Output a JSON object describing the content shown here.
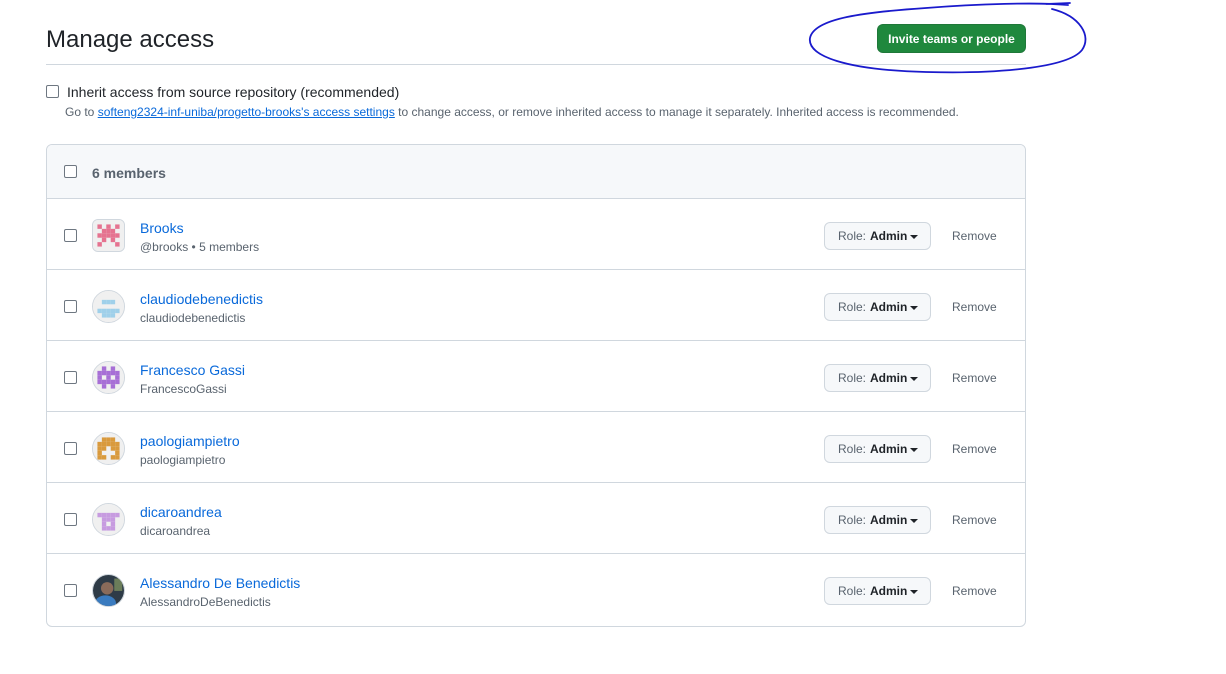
{
  "header": {
    "title": "Manage access",
    "invite_label": "Invite teams or people"
  },
  "inherit": {
    "label": "Inherit access from source repository (recommended)",
    "note_prefix": "Go to ",
    "note_link": "softeng2324-inf-uniba/progetto-brooks's access settings",
    "note_suffix": " to change access, or remove inherited access to manage it separately. Inherited access is recommended."
  },
  "members": {
    "count_label": "6 members",
    "role_prefix": "Role:",
    "remove_label": "Remove",
    "items": [
      {
        "name": "Brooks",
        "sub": "@brooks • 5 members",
        "role": "Admin",
        "avatar": "identicon-pink-team",
        "color": "#e57390"
      },
      {
        "name": "claudiodebenedictis",
        "sub": "claudiodebenedictis",
        "role": "Admin",
        "avatar": "identicon-lightblue",
        "color": "#9fd0ea"
      },
      {
        "name": "Francesco Gassi",
        "sub": "FrancescoGassi",
        "role": "Admin",
        "avatar": "identicon-purple",
        "color": "#a76fd6"
      },
      {
        "name": "paologiampietro",
        "sub": "paologiampietro",
        "role": "Admin",
        "avatar": "identicon-orange",
        "color": "#d99a3d"
      },
      {
        "name": "dicaroandrea",
        "sub": "dicaroandrea",
        "role": "Admin",
        "avatar": "identicon-lilac",
        "color": "#c79be0"
      },
      {
        "name": "Alessandro De Benedictis",
        "sub": "AlessandroDeBenedictis",
        "role": "Admin",
        "avatar": "photo-avatar",
        "color": "#3b4a5a"
      }
    ]
  },
  "colors": {
    "primary_button": "#1f883d",
    "link": "#0969da",
    "annotation": "#1a1acc"
  }
}
